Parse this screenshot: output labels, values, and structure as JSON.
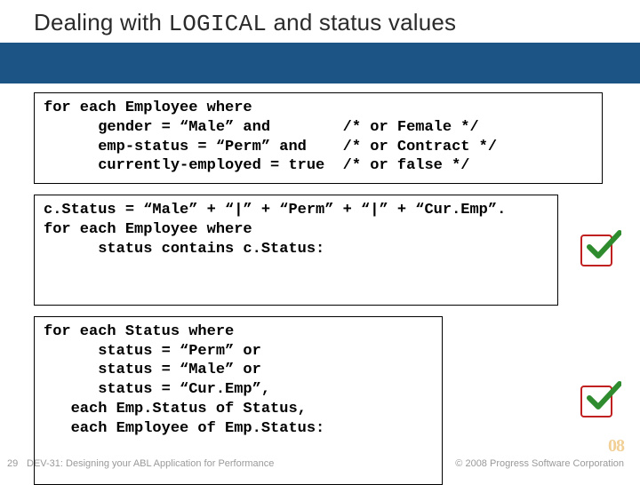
{
  "title": {
    "pre": "Dealing with ",
    "code": "LOGICAL",
    "post": " and status values"
  },
  "code_box_1": "for each Employee where\n      gender = “Male” and        /* or Female */\n      emp-status = “Perm” and    /* or Contract */\n      currently-employed = true  /* or false */",
  "code_box_2": "c.Status = “Male” + “|” + “Perm” + “|” + “Cur.Emp”.\nfor each Employee where\n      status contains c.Status:",
  "code_box_3": "for each Status where\n      status = “Perm” or\n      status = “Male” or\n      status = “Cur.Emp”,\n   each Emp.Status of Status,\n   each Employee of Emp.Status:",
  "footer": {
    "page": "29",
    "session": "DEV-31: Designing your ABL Application for Performance",
    "copyright": "© 2008 Progress Software Corporation"
  },
  "logo": {
    "text": "08"
  },
  "icons": {
    "check": "checkmark-icon"
  }
}
